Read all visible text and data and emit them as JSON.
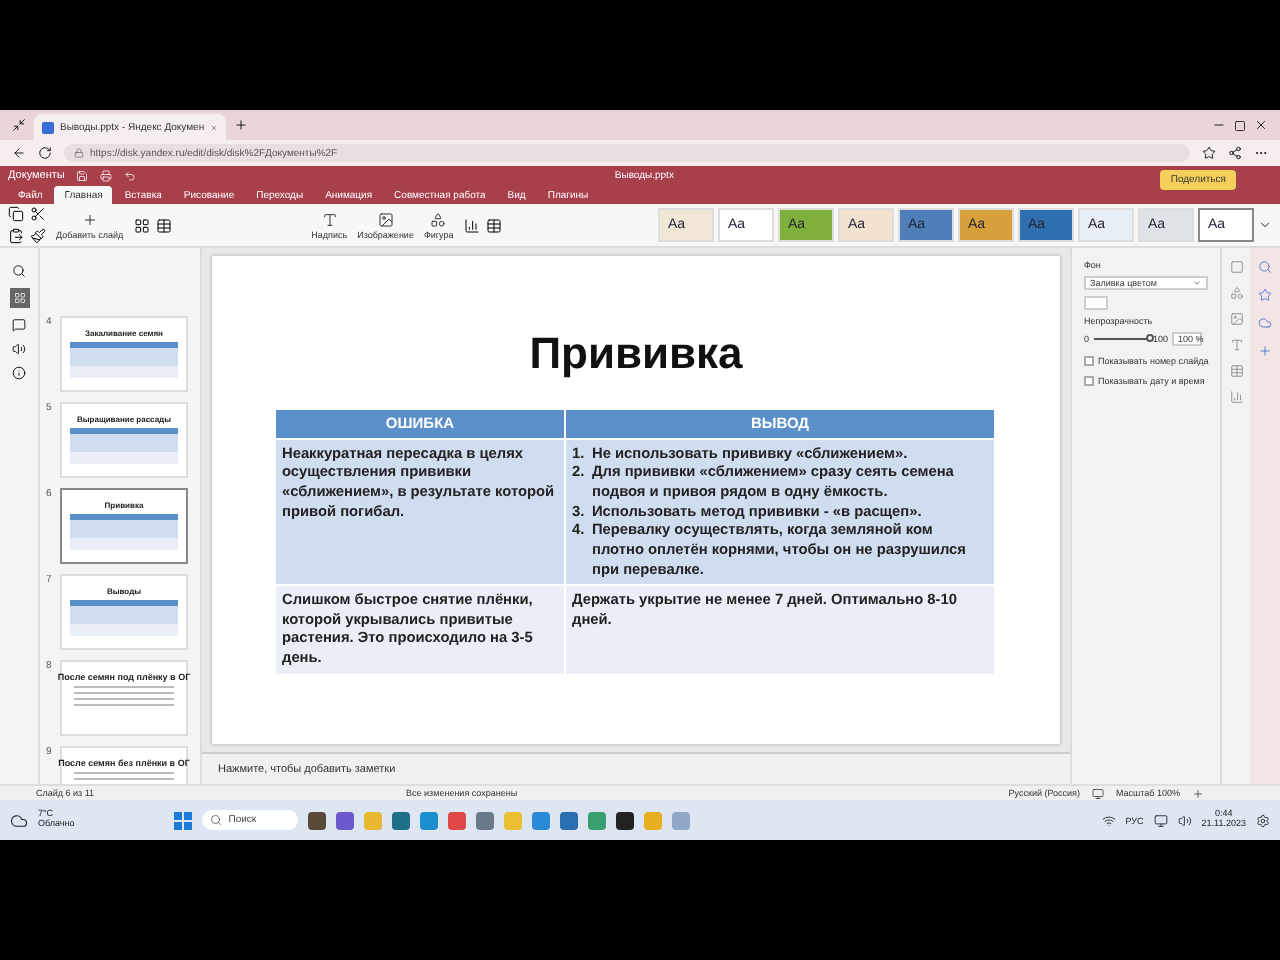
{
  "browser": {
    "tab_title": "Выводы.pptx - Яндекс Докумен",
    "url": "https://disk.yandex.ru/edit/disk/disk%2FДокументы%2F"
  },
  "app": {
    "name": "Документы",
    "doc_title": "Выводы.pptx"
  },
  "menu_tabs": [
    {
      "label": "Файл",
      "selected": false
    },
    {
      "label": "Главная",
      "selected": true
    },
    {
      "label": "Вставка",
      "selected": false
    },
    {
      "label": "Рисование",
      "selected": false
    },
    {
      "label": "Переходы",
      "selected": false
    },
    {
      "label": "Анимация",
      "selected": false
    },
    {
      "label": "Совместная работа",
      "selected": false
    },
    {
      "label": "Вид",
      "selected": false
    },
    {
      "label": "Плагины",
      "selected": false
    }
  ],
  "toolbar": {
    "add_slide": "Добавить слайд",
    "insert_buttons": [
      "Надпись",
      "Изображение",
      "Фигура"
    ],
    "share": "Поделиться"
  },
  "themes": [
    {
      "label": "Aa",
      "color": "#efe6d6",
      "selected": false
    },
    {
      "label": "Aa",
      "color": "#ffffff",
      "selected": false
    },
    {
      "label": "Aa",
      "color": "#7fb03c",
      "selected": false
    },
    {
      "label": "Aa",
      "color": "#f3e2cf",
      "selected": false
    },
    {
      "label": "Aa",
      "color": "#4f7fb8",
      "selected": false
    },
    {
      "label": "Aa",
      "color": "#d8a03a",
      "selected": false
    },
    {
      "label": "Aa",
      "color": "#2f6fb0",
      "selected": false
    },
    {
      "label": "Aa",
      "color": "#e8eef6",
      "selected": false
    },
    {
      "label": "Aa",
      "color": "#dfe3e8",
      "selected": false
    },
    {
      "label": "Aa",
      "color": "#ffffff",
      "selected": true
    }
  ],
  "slides": [
    {
      "number": "4",
      "title": "Закаливание семян",
      "kind": "table",
      "selected": false
    },
    {
      "number": "5",
      "title": "Выращивание рассады",
      "kind": "table",
      "selected": false
    },
    {
      "number": "6",
      "title": "Прививка",
      "kind": "table",
      "selected": true
    },
    {
      "number": "7",
      "title": "Выводы",
      "kind": "table",
      "selected": false
    },
    {
      "number": "8",
      "title": "После семян под плёнку в ОГ",
      "kind": "text",
      "selected": false
    },
    {
      "number": "9",
      "title": "После семян без плёнки в ОГ",
      "kind": "text",
      "selected": false
    }
  ],
  "slide": {
    "title": "Прививка",
    "columns": [
      "ОШИБКА",
      "ВЫВОД"
    ],
    "rows": [
      {
        "kind": "list",
        "error": "Неаккуратная пересадка в целях осуществления прививки «сближением», в результате которой привой погибал.",
        "conclusion": [
          {
            "marker": "1.",
            "text": "Не использовать прививку «сближением»."
          },
          {
            "marker": "2.",
            "text": "Для прививки «сближением» сразу сеять семена подвоя и привоя рядом в одну ёмкость."
          },
          {
            "marker": "3.",
            "text": "Использовать метод прививки - «в расщеп»."
          },
          {
            "marker": "4.",
            "text": "Перевалку осуществлять, когда земляной ком плотно оплетён корнями, чтобы он не разрушился при перевалке."
          }
        ]
      },
      {
        "kind": "text",
        "error": "Слишком быстрое снятие плёнки, которой укрывались привитые растения. Это происходило на 3-5 день.",
        "conclusion": "Держать укрытие не менее 7 дней. Оптимально 8-10 дней."
      }
    ]
  },
  "notes_placeholder": "Нажмите, чтобы добавить заметки",
  "status": {
    "slide_counter": "Слайд 6 из 11",
    "save_state": "Все изменения сохранены",
    "language": "Русский (Россия)",
    "zoom": "Масштаб 100%"
  },
  "format_panel": {
    "background_label": "Фон",
    "fill": "Заливка цветом",
    "opacity_label": "Непрозрачность",
    "opacity": {
      "level": 1,
      "min": "0",
      "max": "100"
    },
    "opacity_value": "100 %",
    "checkboxes": [
      {
        "label": "Показывать номер слайда",
        "checked": false
      },
      {
        "label": "Показывать дату и время",
        "checked": false
      }
    ]
  },
  "taskbar": {
    "weather_temp": "7°C",
    "weather_text": "Облачно",
    "search_placeholder": "Поиск",
    "language": "РУС",
    "time": "0:44",
    "date": "21.11.2023"
  }
}
